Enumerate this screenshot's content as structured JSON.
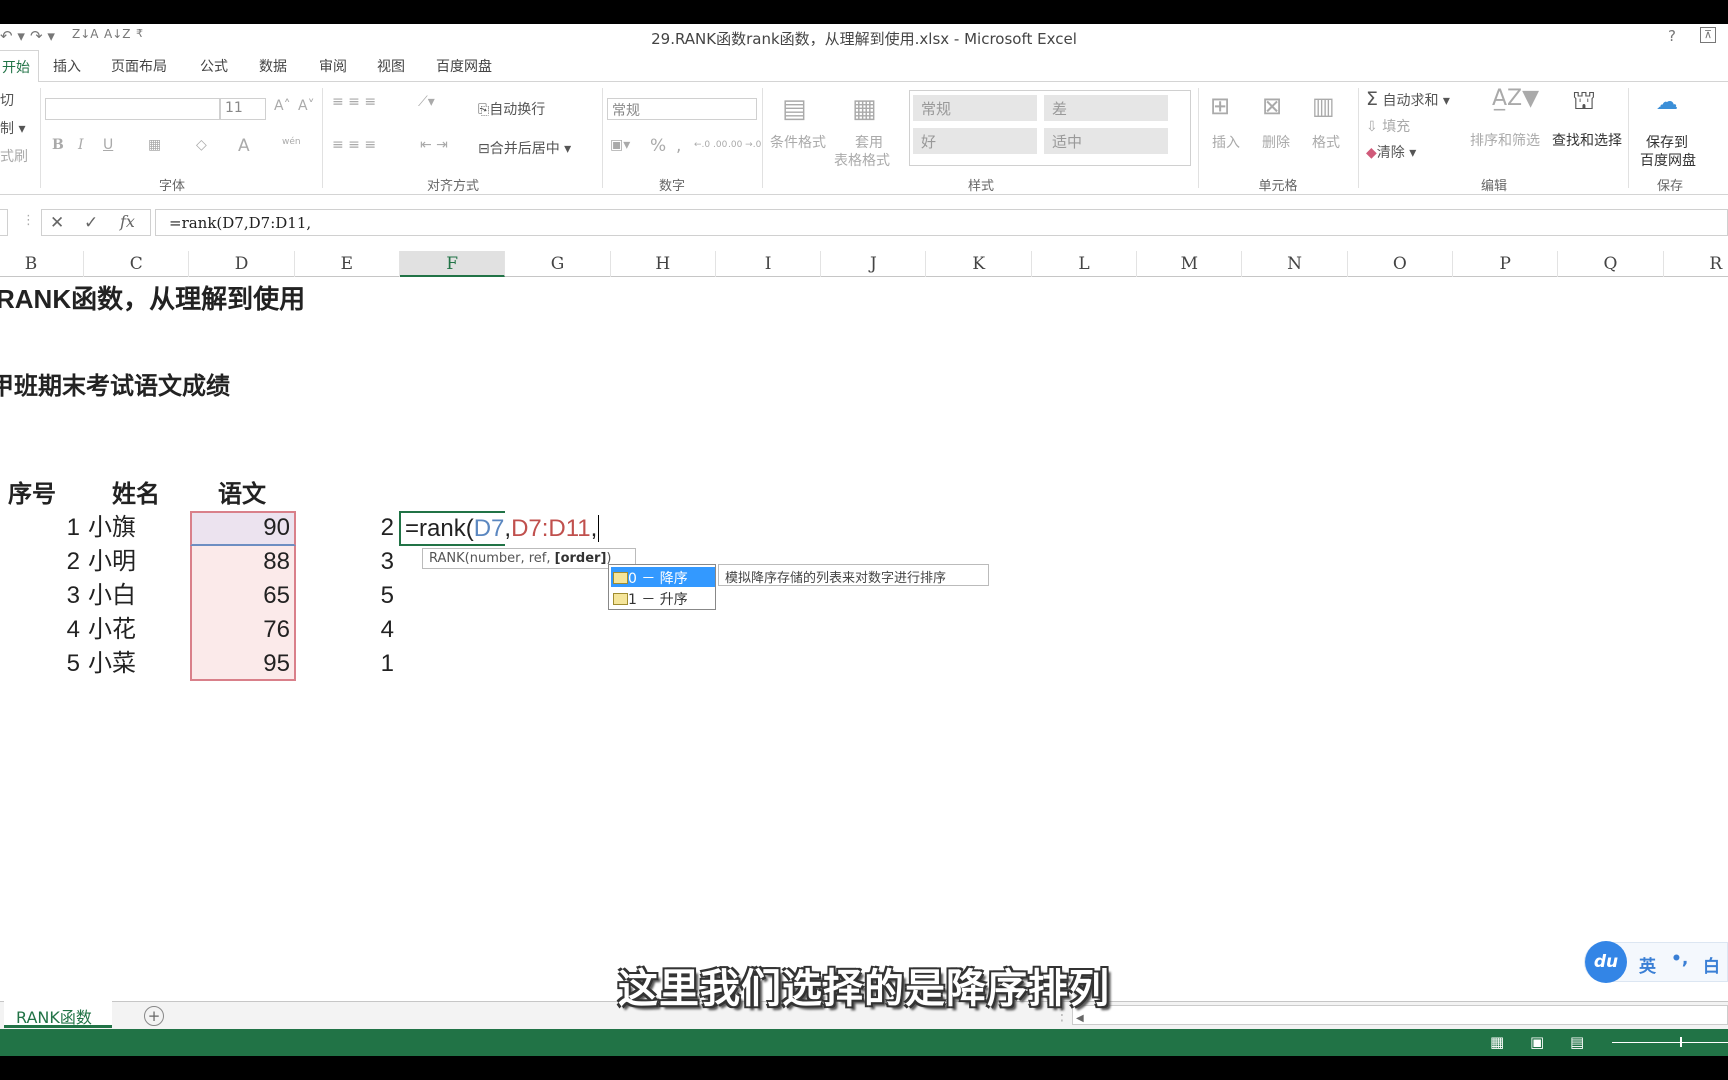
{
  "window": {
    "title": "29.RANK函数rank函数，从理解到使用.xlsx - Microsoft Excel",
    "help": "?",
    "ribbon_display": "⊼"
  },
  "quick_access": {
    "undo": "↶ ▾",
    "redo": "↷ ▾",
    "sort_desc": "Z↓A",
    "sort_asc": "A↓Z",
    "customize": "₹"
  },
  "tabs": [
    {
      "label": "开始",
      "active": true
    },
    {
      "label": "插入"
    },
    {
      "label": "页面布局"
    },
    {
      "label": "公式"
    },
    {
      "label": "数据"
    },
    {
      "label": "审阅"
    },
    {
      "label": "视图"
    },
    {
      "label": "百度网盘"
    }
  ],
  "ribbon": {
    "clipboard": {
      "cut": "切",
      "copy": "制 ▾",
      "format_painter": "式刷"
    },
    "font": {
      "label": "字体",
      "font_size": "11",
      "bold": "B",
      "italic": "I",
      "underline": "U",
      "grow": "A˄",
      "shrink": "A˅",
      "font_color": "A",
      "phonetic": "wén"
    },
    "alignment": {
      "label": "对齐方式",
      "wrap_text": "自动换行",
      "merge_center": "合并后居中"
    },
    "number": {
      "label": "数字",
      "format": "常规",
      "percent": "%",
      "comma": ",",
      "inc_decimal": "←.0 .00",
      "dec_decimal": ".00 →.0"
    },
    "styles": {
      "label": "样式",
      "conditional_format": "条件格式",
      "table_format_1": "套用",
      "table_format_2": "表格格式",
      "cells": [
        "常规",
        "差",
        "好",
        "适中"
      ]
    },
    "cells": {
      "label": "单元格",
      "insert": "插入",
      "delete": "删除",
      "format": "格式"
    },
    "editing": {
      "label": "编辑",
      "autosum": "自动求和",
      "fill": "填充",
      "clear": "清除",
      "sort_filter": "排序和筛选",
      "find_select": "查找和选择"
    },
    "save": {
      "label": "保存",
      "save_to_1": "保存到",
      "save_to_2": "百度网盘"
    }
  },
  "formula_bar": {
    "cancel": "✕",
    "enter": "✓",
    "fx": "fx",
    "value": "=rank(D7,D7:D11,"
  },
  "columns": [
    "B",
    "C",
    "D",
    "E",
    "F",
    "G",
    "H",
    "I",
    "J",
    "K",
    "L",
    "M",
    "N",
    "O",
    "P",
    "Q",
    "R"
  ],
  "selected_column": "F",
  "sheet": {
    "title": "RANK函数，从理解到使用",
    "subtitle": "甲班期末考试语文成绩",
    "headers": {
      "index": "序号",
      "name": "姓名",
      "chinese": "语文"
    },
    "rows": [
      {
        "index": "1",
        "name": "小旗",
        "score": "90",
        "rank": "2"
      },
      {
        "index": "2",
        "name": "小明",
        "score": "88",
        "rank": "3"
      },
      {
        "index": "3",
        "name": "小白",
        "score": "65",
        "rank": "5"
      },
      {
        "index": "4",
        "name": "小花",
        "score": "76",
        "rank": "4"
      },
      {
        "index": "5",
        "name": "小菜",
        "score": "95",
        "rank": "1"
      }
    ],
    "editing_cell": {
      "part1": "=rank(",
      "ref1": "D7",
      "comma1": ",",
      "ref2": "D7:D11",
      "comma2": ","
    },
    "ref1_color": "#5b87c0",
    "ref2_color": "#c0504d"
  },
  "tooltip": {
    "prefix": "RANK(number, ref, ",
    "bold": "[order]",
    "suffix": ")"
  },
  "autocomplete": {
    "options": [
      {
        "label": "0 － 降序",
        "selected": true
      },
      {
        "label": "1 － 升序"
      }
    ],
    "description": "模拟降序存储的列表来对数字进行排序"
  },
  "sheet_tabs": [
    {
      "label": "RANK函数",
      "active": true
    }
  ],
  "add_sheet": "+",
  "caption": "这里我们选择的是降序排列",
  "ime": {
    "logo": "du",
    "lang": "英",
    "punct": "•,",
    "extra": "白"
  },
  "colors": {
    "excel_green": "#217346",
    "selection_fill": "#fbeaea",
    "highlight_blue": "#3399ff"
  }
}
